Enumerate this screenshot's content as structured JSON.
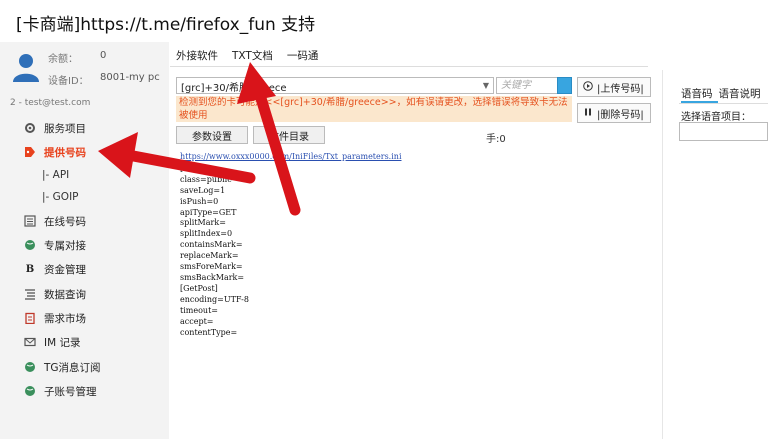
{
  "window": {
    "title": "[卡商端]https://t.me/firefox_fun 支持"
  },
  "account": {
    "balance_label": "余额：",
    "balance_value": "0",
    "device_label": "设备ID：",
    "device_value": "8001-my pc",
    "user_line": "2 - test@test.com"
  },
  "sidebar": {
    "items": [
      {
        "label": "服务项目",
        "icon": "gear-icon"
      },
      {
        "label": "提供号码",
        "icon": "tag-icon"
      },
      {
        "label": "在线号码",
        "icon": "list-icon"
      },
      {
        "label": "专属对接",
        "icon": "globe-icon"
      },
      {
        "label": "资金管理",
        "icon": "bold-b-icon"
      },
      {
        "label": "数据查询",
        "icon": "lines-icon"
      },
      {
        "label": "需求市场",
        "icon": "clipboard-icon"
      },
      {
        "label": "IM 记录",
        "icon": "mail-icon"
      },
      {
        "label": "TG消息订阅",
        "icon": "globe-icon"
      },
      {
        "label": "子账号管理",
        "icon": "globe-icon"
      }
    ],
    "sub_items": [
      {
        "label": "|-  API"
      },
      {
        "label": "|-  GOIP"
      }
    ]
  },
  "tabs": [
    {
      "label": "外接软件"
    },
    {
      "label": "TXT文档"
    },
    {
      "label": "一码通"
    }
  ],
  "project_combo": {
    "value": "[grc]+30/希腊/greece"
  },
  "search": {
    "placeholder": "关键字"
  },
  "warning": {
    "text": "检测到您的卡可能是<<[grc]+30/希腊/greece>>，如有误请更改，选择错误将导致卡无法被使用"
  },
  "side_buttons": [
    {
      "label": "|上传号码|"
    },
    {
      "label": "|删除号码|"
    }
  ],
  "buttons": {
    "param_settings": "参数设置",
    "file_dir": "文件目录"
  },
  "count_label": "手:0",
  "ini": {
    "link": "https://www.oxxx0000.com/IniFiles/Txt_parameters.ini",
    "lines": [
      "[Base]",
      "class=public",
      "saveLog=1",
      "isPush=0",
      "apiType=GET",
      "splitMark=",
      "splitIndex=0",
      "containsMark=",
      "replaceMark=",
      "smsForeMark=",
      "smsBackMark=",
      "[GetPost]",
      "encoding=UTF-8",
      "timeout=",
      "accept=",
      "contentType="
    ]
  },
  "voice": {
    "tabs": [
      {
        "label": "语音码"
      },
      {
        "label": "语音说明"
      }
    ],
    "select_label": "选择语音项目："
  },
  "colors": {
    "accent": "#38a5e0",
    "active_nav": "#e8421d",
    "warning_bg": "#fbe7cd",
    "arrow": "#d9141a"
  }
}
